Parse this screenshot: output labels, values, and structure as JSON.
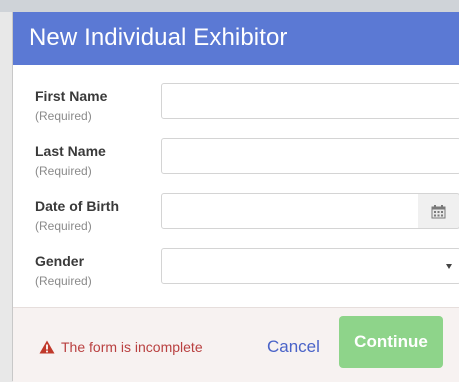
{
  "modal": {
    "title": "New Individual Exhibitor"
  },
  "form": {
    "fields": [
      {
        "label": "First Name",
        "hint": "(Required)",
        "value": ""
      },
      {
        "label": "Last Name",
        "hint": "(Required)",
        "value": ""
      },
      {
        "label": "Date of Birth",
        "hint": "(Required)",
        "value": "",
        "icon": "calendar-icon"
      },
      {
        "label": "Gender",
        "hint": "(Required)",
        "value": "",
        "icon": "caret-down-icon"
      }
    ]
  },
  "footer": {
    "status_icon": "warning-icon",
    "status_text": "The form is incomplete",
    "cancel_label": "Cancel",
    "continue_label": "Continue"
  },
  "colors": {
    "header": "#5b79d4",
    "continue": "#8ed48a",
    "warning": "#b94040",
    "link": "#4a63c8"
  }
}
